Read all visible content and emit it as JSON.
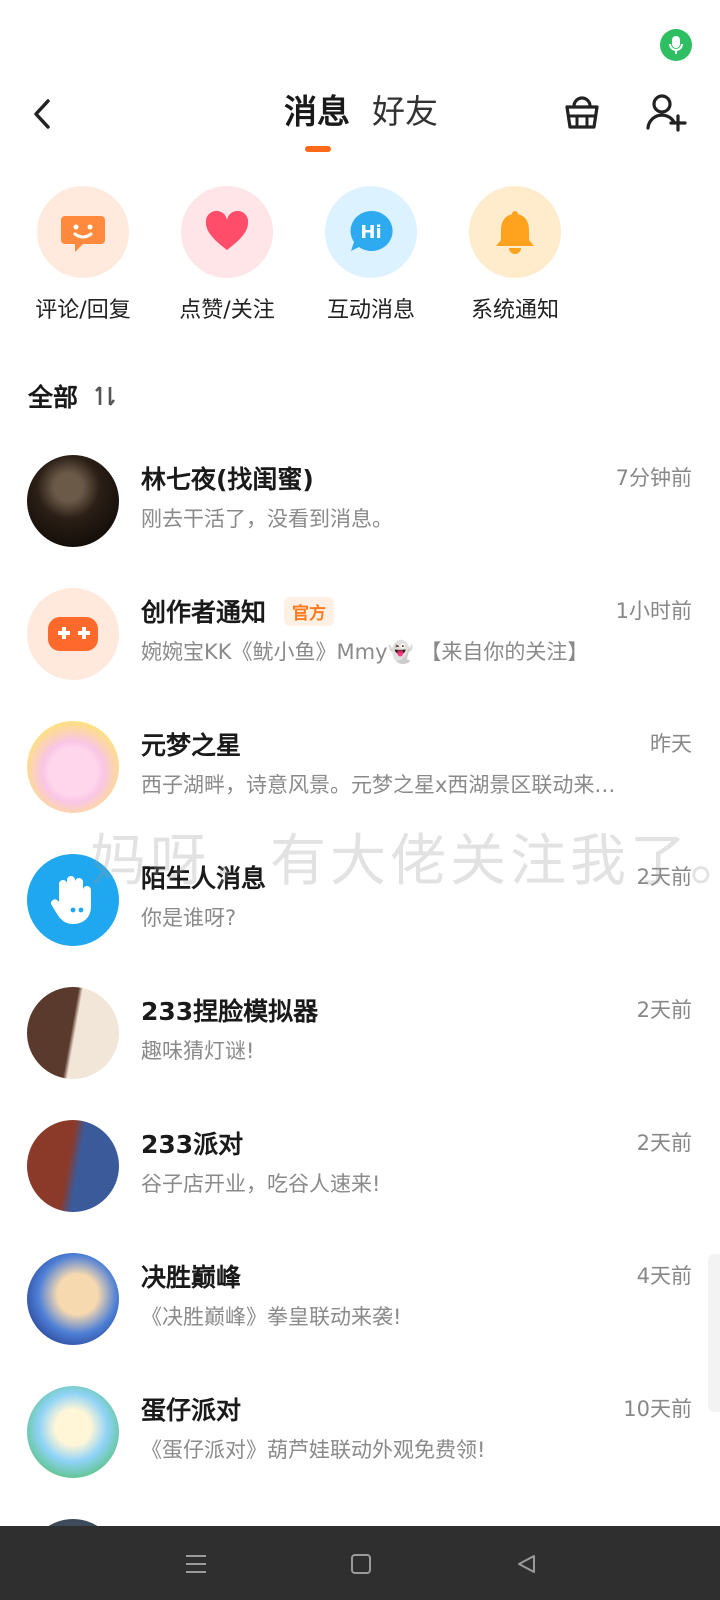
{
  "header": {
    "tabs": [
      {
        "label": "消息",
        "active": true
      },
      {
        "label": "好友",
        "active": false
      }
    ],
    "accent": "#ff6a1a"
  },
  "shortcuts": [
    {
      "label": "评论/回复",
      "icon": "chat-smile-icon",
      "bg": "#ffeadd",
      "color": "#ff8a3d"
    },
    {
      "label": "点赞/关注",
      "icon": "heart-icon",
      "bg": "#ffe5e8",
      "color": "#ff4d6a"
    },
    {
      "label": "互动消息",
      "icon": "hi-bubble-icon",
      "bg": "#ddf2ff",
      "color": "#2eaaf0"
    },
    {
      "label": "系统通知",
      "icon": "bell-icon",
      "bg": "#ffeccc",
      "color": "#ffa21e"
    }
  ],
  "section": {
    "title": "全部",
    "sort_glyph": "1↓"
  },
  "conversations": [
    {
      "name": "林七夜(找闺蜜)",
      "time": "7分钟前",
      "preview": "刚去干活了，没看到消息。",
      "badge": ""
    },
    {
      "name": "创作者通知",
      "time": "1小时前",
      "preview": "婉婉宝KK《鱿小鱼》Mmy👻 【来自你的关注】",
      "badge": "官方"
    },
    {
      "name": "元梦之星",
      "time": "昨天",
      "preview": "西子湖畔，诗意风景。元梦之星x西湖景区联动来…",
      "badge": ""
    },
    {
      "name": "陌生人消息",
      "time": "2天前",
      "preview": "你是谁呀?",
      "badge": ""
    },
    {
      "name": "233捏脸模拟器",
      "time": "2天前",
      "preview": "趣味猜灯谜!",
      "badge": ""
    },
    {
      "name": "233派对",
      "time": "2天前",
      "preview": "谷子店开业，吃谷人速来!",
      "badge": ""
    },
    {
      "name": "决胜巅峰",
      "time": "4天前",
      "preview": "《决胜巅峰》拳皇联动来袭!",
      "badge": ""
    },
    {
      "name": "蛋仔派对",
      "time": "10天前",
      "preview": "《蛋仔派对》葫芦娃联动外观免费领!",
      "badge": ""
    }
  ],
  "watermark": "妈呀，有大佬关注我了。"
}
